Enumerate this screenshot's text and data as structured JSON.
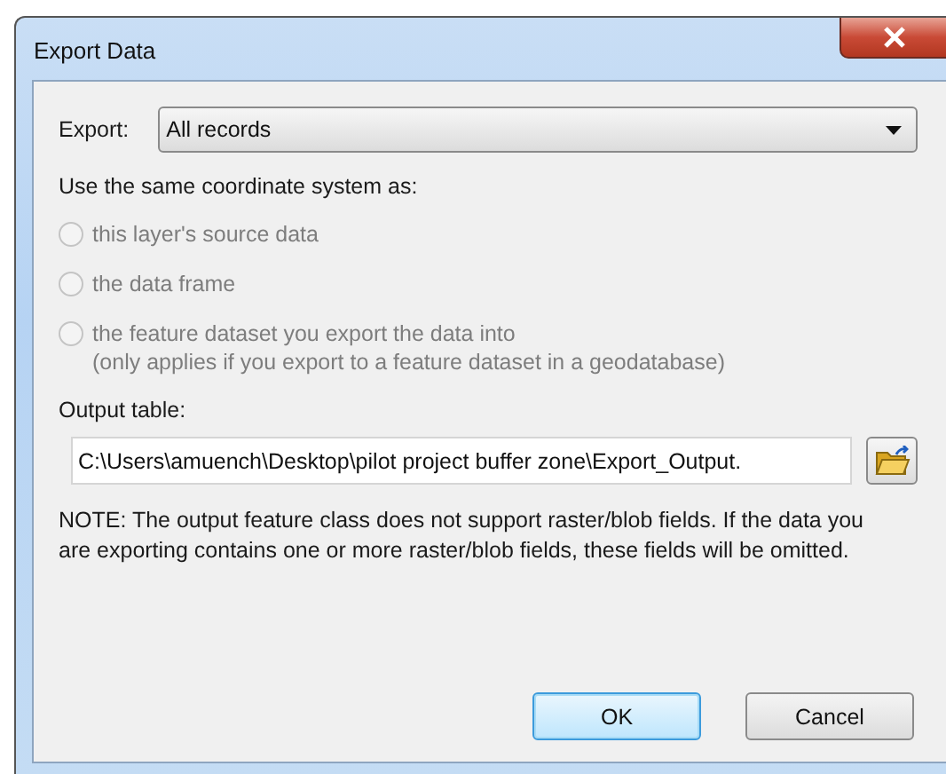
{
  "window": {
    "title": "Export Data"
  },
  "export": {
    "label": "Export:",
    "value": "All records"
  },
  "coordinate_heading": "Use the same coordinate system as:",
  "options": [
    {
      "label": "this layer's source data",
      "selected": false,
      "disabled": true
    },
    {
      "label": "the data frame",
      "selected": false,
      "disabled": true
    },
    {
      "label": "the feature dataset you export the data into",
      "note": "(only applies if you export to a feature dataset in a geodatabase)",
      "selected": false,
      "disabled": true
    }
  ],
  "output": {
    "label": "Output table:",
    "value": "C:\\Users\\amuench\\Desktop\\pilot project buffer zone\\Export_Output."
  },
  "note": "NOTE: The output feature class does not support raster/blob fields. If the data you are exporting contains one or more raster/blob fields, these fields will be omitted.",
  "buttons": [
    {
      "label": "OK",
      "default": true
    },
    {
      "label": "Cancel",
      "default": false
    }
  ]
}
